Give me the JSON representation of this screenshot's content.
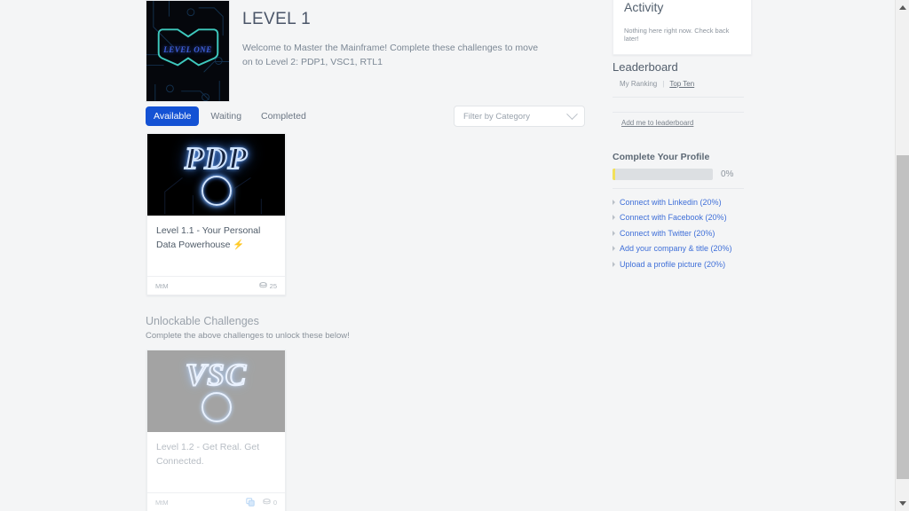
{
  "hero": {
    "thumb_alt": "level-one-badge",
    "thumb_text": "LEVEL ONE",
    "title": "LEVEL 1",
    "description": "Welcome to Master the Mainframe! Complete these challenges to move on to Level 2: PDP1, VSC1, RTL1"
  },
  "tabs": [
    {
      "label": "Available",
      "active": true
    },
    {
      "label": "Waiting",
      "active": false
    },
    {
      "label": "Completed",
      "active": false
    }
  ],
  "filter": {
    "placeholder": "Filter by Category",
    "value": "Filter by Category",
    "icon": "chevron-down-icon"
  },
  "challenges": [
    {
      "image_word": "PDP",
      "title": "Level 1.1 - Your Personal Data Powerhouse ⚡",
      "author": "MtM",
      "points": "25",
      "points_icon": "coins-icon",
      "locked": false
    }
  ],
  "unlockable": {
    "heading": "Unlockable Challenges",
    "subheading": "Complete the above challenges to unlock these below!",
    "challenges": [
      {
        "image_word": "VSC",
        "title": "Level 1.2 - Get Real. Get Connected.",
        "author": "MtM",
        "points": "0",
        "points_icon": "coins-icon",
        "lock_icon": "layers-lock-icon",
        "locked": true
      }
    ]
  },
  "sidebar": {
    "activity": {
      "title": "Activity",
      "empty_text": "Nothing here right now. Check back later!"
    },
    "leaderboard": {
      "title": "Leaderboard",
      "my_ranking": "My Ranking",
      "separator": "|",
      "top_ten": "Top Ten",
      "add_link": "Add me to leaderboard"
    },
    "profile": {
      "title": "Complete Your Profile",
      "percent": "0%",
      "progress_value": 0,
      "items": [
        "Connect with Linkedin (20%)",
        "Connect with Facebook (20%)",
        "Connect with Twitter (20%)",
        "Add your company & title (20%)",
        "Upload a profile picture (20%)"
      ]
    }
  },
  "scrollbar": {
    "up_icon": "scroll-up-arrow-icon",
    "down_icon": "scroll-down-arrow-icon"
  },
  "colors": {
    "accent_blue": "#1452d4",
    "link_blue": "#3f6fd8",
    "progress_yellow": "#f2e05a",
    "page_bg": "#f4f5f6"
  }
}
